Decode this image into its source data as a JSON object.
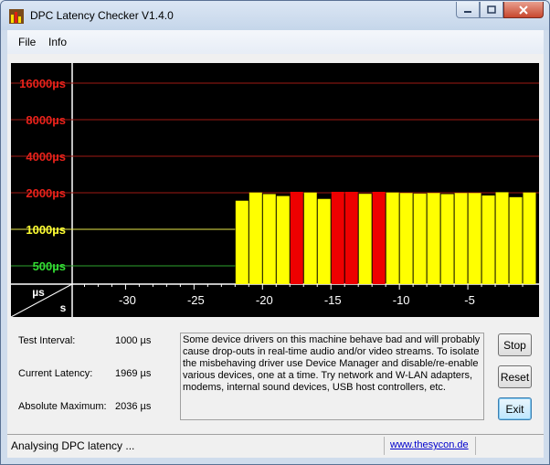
{
  "window": {
    "title": "DPC Latency Checker V1.4.0"
  },
  "menu": {
    "items": [
      "File",
      "Info"
    ]
  },
  "chart_data": {
    "type": "bar",
    "y_ticks": [
      {
        "label": "16000µs",
        "value": 16000,
        "color": "#e8221b"
      },
      {
        "label": "8000µs",
        "value": 8000,
        "color": "#e8221b"
      },
      {
        "label": "4000µs",
        "value": 4000,
        "color": "#e8221b"
      },
      {
        "label": "2000µs",
        "value": 2000,
        "color": "#e8221b"
      },
      {
        "label": "1000µs",
        "value": 1000,
        "color": "#ffff33"
      },
      {
        "label": "500µs",
        "value": 500,
        "color": "#33dd33"
      }
    ],
    "x_ticks": [
      {
        "label": "-30",
        "value": -30
      },
      {
        "label": "-25",
        "value": -25
      },
      {
        "label": "-20",
        "value": -20
      },
      {
        "label": "-15",
        "value": -15
      },
      {
        "label": "-10",
        "value": -10
      },
      {
        "label": "-5",
        "value": -5
      }
    ],
    "xlim": [
      -33.9,
      0.2
    ],
    "corner_top": "µs",
    "corner_bottom": "s",
    "bars": [
      {
        "x": -21.5,
        "value": 1720,
        "color": "yellow"
      },
      {
        "x": -20.5,
        "value": 2010,
        "color": "yellow"
      },
      {
        "x": -19.5,
        "value": 1950,
        "color": "yellow"
      },
      {
        "x": -18.5,
        "value": 1880,
        "color": "yellow"
      },
      {
        "x": -17.5,
        "value": 2036,
        "color": "red"
      },
      {
        "x": -16.5,
        "value": 2010,
        "color": "yellow"
      },
      {
        "x": -15.5,
        "value": 1780,
        "color": "yellow"
      },
      {
        "x": -14.5,
        "value": 2036,
        "color": "red"
      },
      {
        "x": -13.5,
        "value": 2036,
        "color": "red"
      },
      {
        "x": -12.5,
        "value": 1960,
        "color": "yellow"
      },
      {
        "x": -11.5,
        "value": 2036,
        "color": "red"
      },
      {
        "x": -10.5,
        "value": 2010,
        "color": "yellow"
      },
      {
        "x": -9.5,
        "value": 1990,
        "color": "yellow"
      },
      {
        "x": -8.5,
        "value": 1970,
        "color": "yellow"
      },
      {
        "x": -7.5,
        "value": 1990,
        "color": "yellow"
      },
      {
        "x": -6.5,
        "value": 1950,
        "color": "yellow"
      },
      {
        "x": -5.5,
        "value": 1990,
        "color": "yellow"
      },
      {
        "x": -4.5,
        "value": 1990,
        "color": "yellow"
      },
      {
        "x": -3.5,
        "value": 1900,
        "color": "yellow"
      },
      {
        "x": -2.5,
        "value": 2020,
        "color": "yellow"
      },
      {
        "x": -1.5,
        "value": 1840,
        "color": "yellow"
      },
      {
        "x": -0.5,
        "value": 2010,
        "color": "yellow"
      }
    ]
  },
  "stats": {
    "interval_label": "Test Interval:",
    "interval_value": "1000 µs",
    "current_label": "Current Latency:",
    "current_value": "1969 µs",
    "max_label": "Absolute Maximum:",
    "max_value": "2036 µs"
  },
  "info_text": "Some device drivers on this machine behave bad and will probably cause drop-outs in real-time audio and/or video streams. To isolate the misbehaving driver use Device Manager and disable/re-enable various devices, one at a time. Try network and W-LAN adapters, modems, internal sound devices, USB host controllers, etc.",
  "buttons": {
    "stop": "Stop",
    "reset": "Reset",
    "exit": "Exit"
  },
  "status": {
    "text": "Analysing DPC latency ...",
    "link": "www.thesycon.de"
  },
  "colors": {
    "bar_yellow": "#ffff00",
    "bar_red": "#ee0000",
    "grid_red": "#a01a14",
    "grid_yellow": "#e8e84a",
    "grid_green": "#2ea52e"
  }
}
